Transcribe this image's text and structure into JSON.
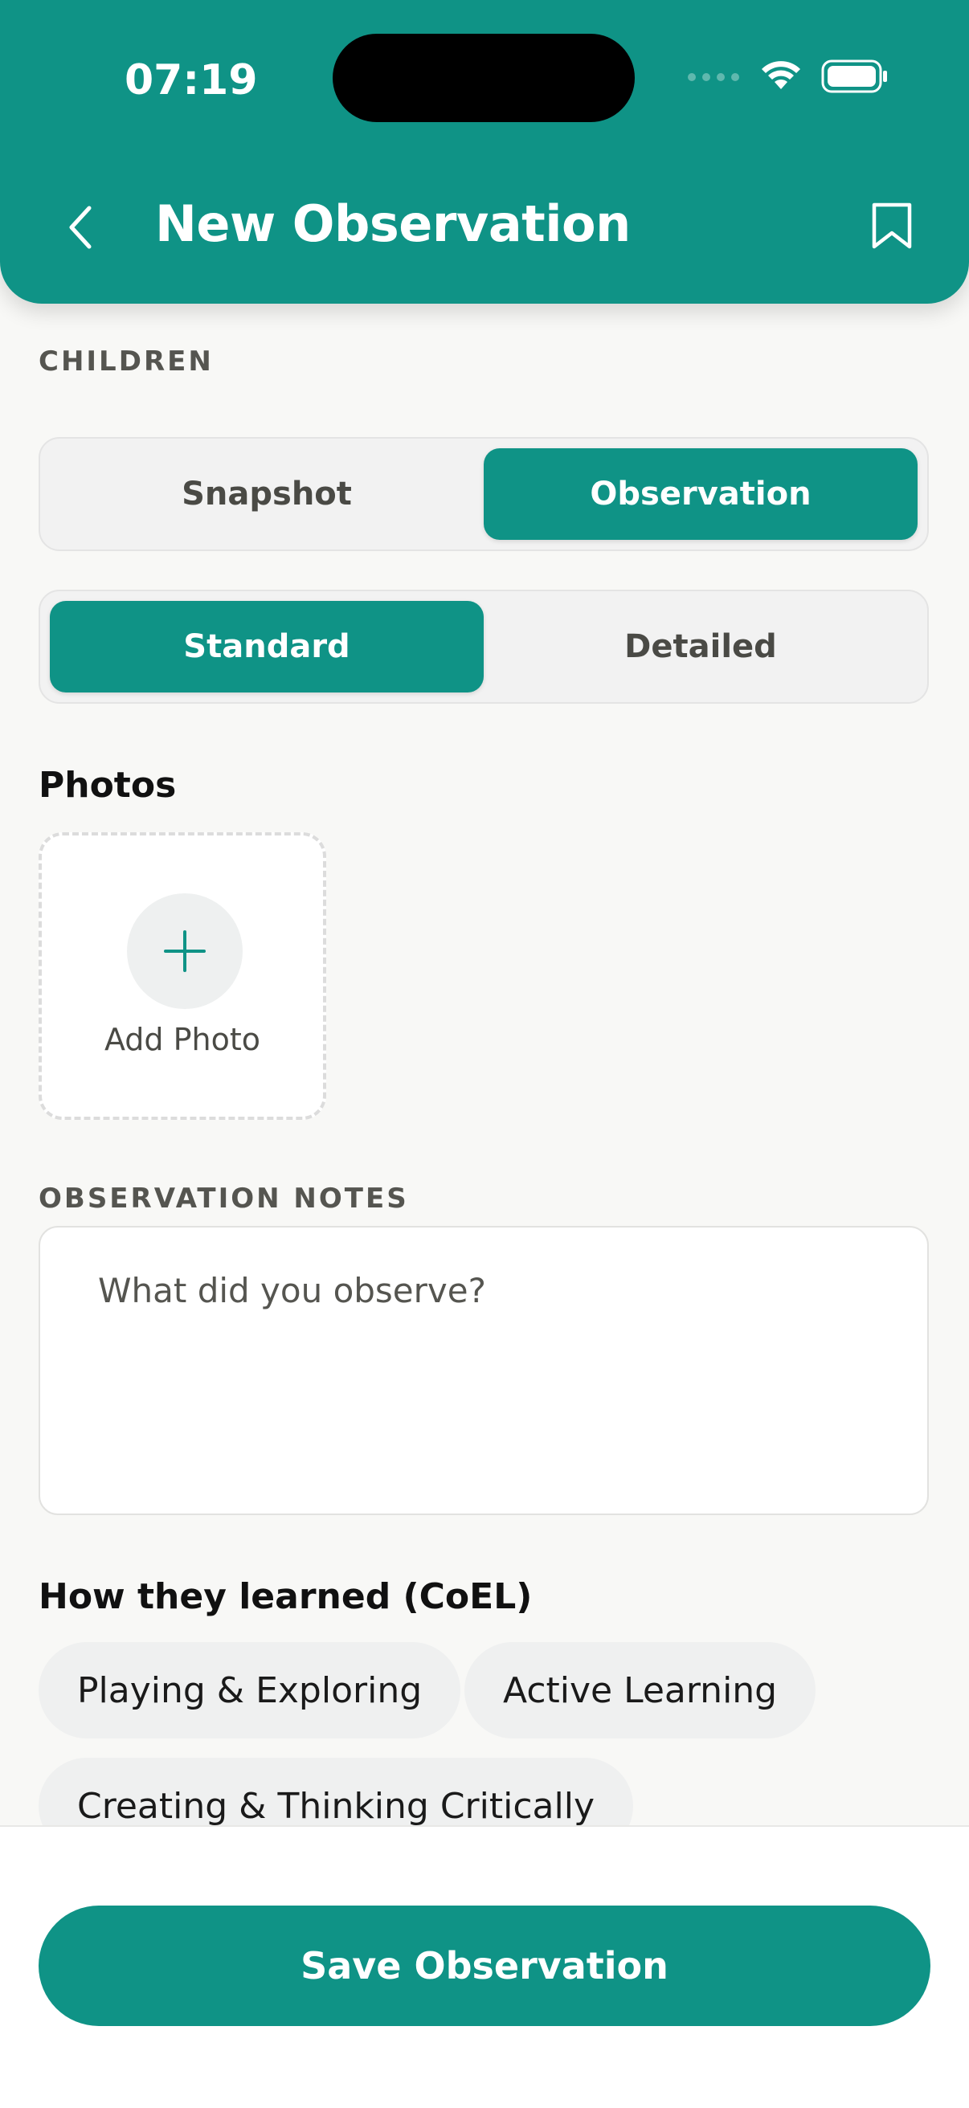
{
  "status_bar": {
    "time": "07:19"
  },
  "header": {
    "title": "New Observation",
    "back_icon": "chevron-left-icon",
    "bookmark_icon": "bookmark-icon"
  },
  "children_section": {
    "label": "CHILDREN"
  },
  "type_toggle": {
    "options": [
      "Snapshot",
      "Observation"
    ],
    "selected": "Observation"
  },
  "detail_toggle": {
    "options": [
      "Standard",
      "Detailed"
    ],
    "selected": "Standard"
  },
  "photos": {
    "heading": "Photos",
    "add_label": "Add Photo"
  },
  "notes": {
    "label": "OBSERVATION NOTES",
    "placeholder": "What did you observe?",
    "value": ""
  },
  "coel": {
    "heading": "How they learned (CoEL)",
    "chips": [
      "Playing & Exploring",
      "Active Learning",
      "Creating & Thinking Critically"
    ]
  },
  "footer": {
    "save_label": "Save Observation"
  },
  "colors": {
    "brand": "#0f9386",
    "background": "#f8f8f6"
  }
}
